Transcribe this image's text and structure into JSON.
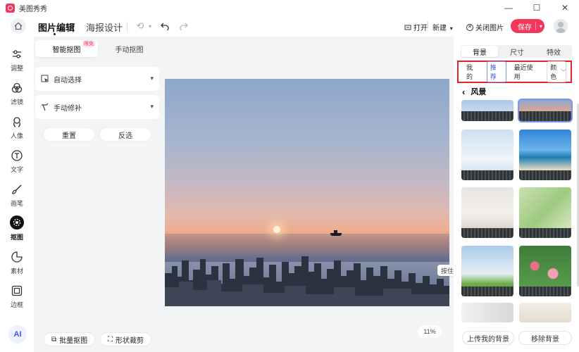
{
  "app": {
    "title": "美图秀秀"
  },
  "window": {
    "minimize": "—",
    "maximize": "☐",
    "close": "✕"
  },
  "header": {
    "tab_edit": "图片编辑",
    "tab_poster": "海报设计",
    "open_label": "打开",
    "new_label": "新建",
    "close_image_label": "关闭图片",
    "save_label": "保存"
  },
  "rail": {
    "items": [
      {
        "label": "调整",
        "icon": "sliders-icon"
      },
      {
        "label": "滤镜",
        "icon": "filter-icon"
      },
      {
        "label": "人像",
        "icon": "portrait-icon"
      },
      {
        "label": "文字",
        "icon": "text-icon"
      },
      {
        "label": "画笔",
        "icon": "brush-icon"
      },
      {
        "label": "抠图",
        "icon": "cutout-icon",
        "active": true
      },
      {
        "label": "素材",
        "icon": "sticker-icon"
      },
      {
        "label": "边框",
        "icon": "frame-icon"
      }
    ],
    "ai_badge": "AI"
  },
  "tool_panel": {
    "tab_smart": "智能抠图",
    "tab_smart_badge": "限免",
    "tab_manual": "手动抠图",
    "auto_select": "自动选择",
    "manual_fix": "手动修补",
    "reset": "重置",
    "invert": "反选",
    "batch_cutout": "批量抠图",
    "shape_crop": "形状裁剪"
  },
  "canvas": {
    "zoom": "11%",
    "hint": "按住空格键可拖动整张图片~"
  },
  "right_panel": {
    "tabs": [
      "背景",
      "尺寸",
      "特效"
    ],
    "categories": [
      "我的",
      "推荐",
      "最近使用",
      "颜色"
    ],
    "section_title": "风景",
    "upload_bg": "上传我的背景",
    "remove_bg": "移除背景"
  },
  "colors": {
    "accent": "#f5365c",
    "highlight_border": "#e3242b",
    "selection": "#7a95ee"
  }
}
